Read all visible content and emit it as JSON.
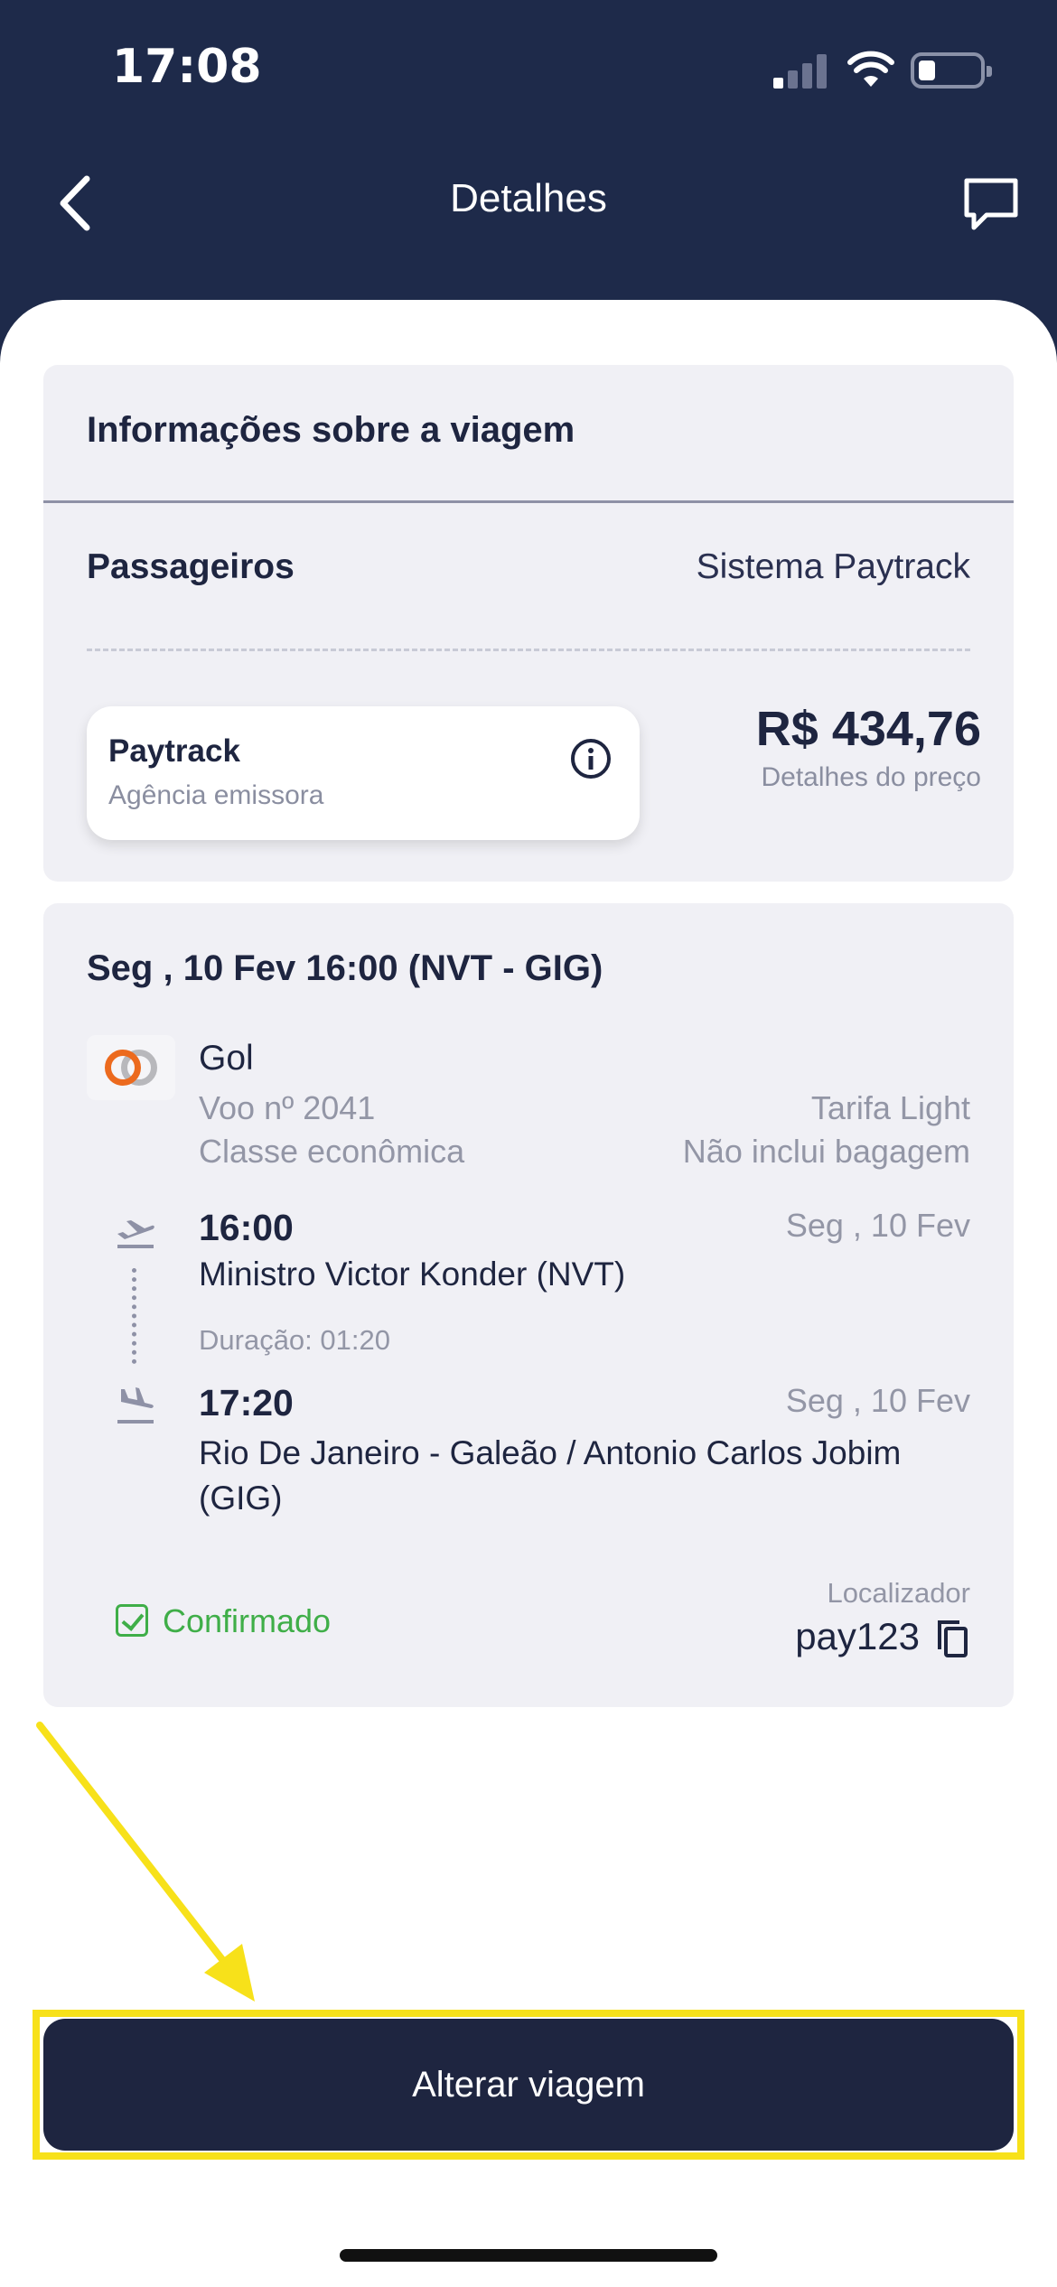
{
  "status_bar": {
    "time": "17:08"
  },
  "nav": {
    "title": "Detalhes"
  },
  "trip_info": {
    "title": "Informações sobre a viagem",
    "passengers_label": "Passageiros",
    "passengers_value": "Sistema Paytrack",
    "agency_name": "Paytrack",
    "agency_subtitle": "Agência emissora",
    "price": "R$ 434,76",
    "price_details_link": "Detalhes do preço"
  },
  "flight": {
    "header": "Seg , 10 Fev 16:00 (NVT - GIG)",
    "airline": "Gol",
    "flight_number": "Voo nº 2041",
    "fare": "Tarifa Light",
    "cabin": "Classe econômica",
    "baggage": "Não inclui bagagem",
    "departure": {
      "time": "16:00",
      "date": "Seg , 10 Fev",
      "airport": "Ministro Victor Konder (NVT)"
    },
    "duration": "Duração: 01:20",
    "arrival": {
      "time": "17:20",
      "date": "Seg , 10 Fev",
      "airport": "Rio De Janeiro - Galeão / Antonio Carlos Jobim (GIG)"
    },
    "status": "Confirmado",
    "locator_label": "Localizador",
    "locator_value": "pay123"
  },
  "actions": {
    "change_trip": "Alterar viagem"
  },
  "colors": {
    "header_bg": "#1e2a4a",
    "status_green": "#3fae48",
    "highlight": "#f7e11a",
    "airline_orange": "#ec6a1e"
  },
  "icons": [
    "back-arrow-icon",
    "chat-icon",
    "info-icon",
    "gol-logo-icon",
    "departure-plane-icon",
    "arrival-plane-icon",
    "checkbox-checked-icon",
    "copy-icon"
  ]
}
